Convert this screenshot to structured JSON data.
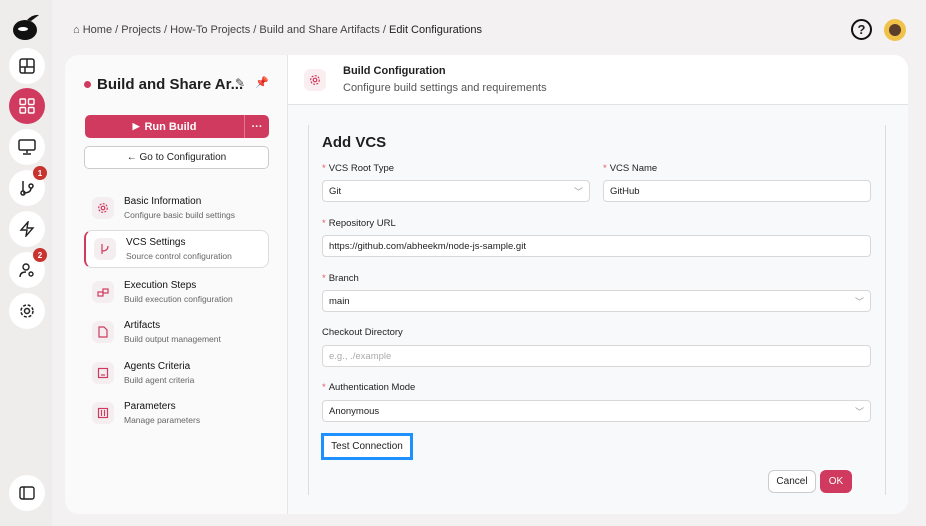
{
  "breadcrumb": {
    "items": [
      "Home",
      "Projects",
      "How-To Projects",
      "Build and Share Artifacts",
      "Edit Configurations"
    ]
  },
  "rail": {
    "badges": {
      "vcs": "1",
      "users": "2"
    }
  },
  "project": {
    "title": "Build and Share Ar...",
    "run_label": "Run Build",
    "more_label": "···",
    "goto_label": "← Go to Configuration"
  },
  "nav": [
    {
      "title": "Basic Information",
      "sub": "Configure basic build settings"
    },
    {
      "title": "VCS Settings",
      "sub": "Source control configuration"
    },
    {
      "title": "Execution Steps",
      "sub": "Build execution configuration"
    },
    {
      "title": "Artifacts",
      "sub": "Build output management"
    },
    {
      "title": "Agents Criteria",
      "sub": "Build agent criteria"
    },
    {
      "title": "Parameters",
      "sub": "Manage parameters"
    }
  ],
  "header": {
    "title": "Build Configuration",
    "subtitle": "Configure build settings and requirements"
  },
  "form": {
    "title": "Add VCS",
    "vcs_root_type": {
      "label": "VCS Root Type",
      "value": "Git"
    },
    "vcs_name": {
      "label": "VCS Name",
      "value": "GitHub"
    },
    "repo_url": {
      "label": "Repository URL",
      "value": "https://github.com/abheekm/node-js-sample.git"
    },
    "branch": {
      "label": "Branch",
      "value": "main"
    },
    "checkout": {
      "label": "Checkout Directory",
      "placeholder": "e.g., ./example"
    },
    "auth": {
      "label": "Authentication Mode",
      "value": "Anonymous"
    },
    "test_label": "Test Connection",
    "cancel_label": "Cancel",
    "ok_label": "OK"
  },
  "colors": {
    "accent": "#d03a5e",
    "focus": "#1e90ff"
  }
}
